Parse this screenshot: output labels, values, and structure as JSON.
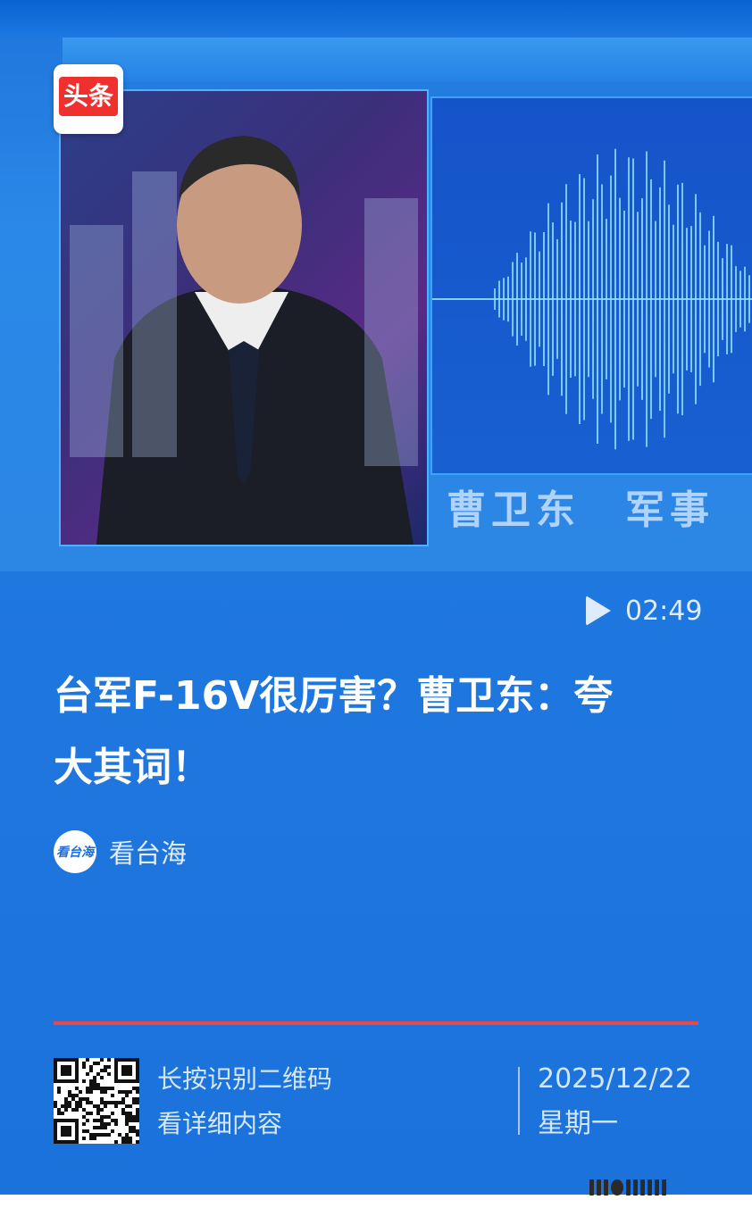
{
  "app": {
    "logo_text": "头条"
  },
  "video": {
    "caption": "曹卫东　军事",
    "duration": "02:49",
    "play_icon": "play-icon"
  },
  "article": {
    "title_line1": "台军F-16V很厉害？曹卫东：夸",
    "title_line2": "大其词！",
    "author_name": "看台海",
    "author_avatar_text": "看台海"
  },
  "footer": {
    "qr_line1": "长按识别二维码",
    "qr_line2": "看详细内容",
    "date": "2025/12/22",
    "weekday": "星期一"
  },
  "colors": {
    "background": "#1f78e0",
    "divider": "#e8484a",
    "logo_red": "#f0302f"
  }
}
